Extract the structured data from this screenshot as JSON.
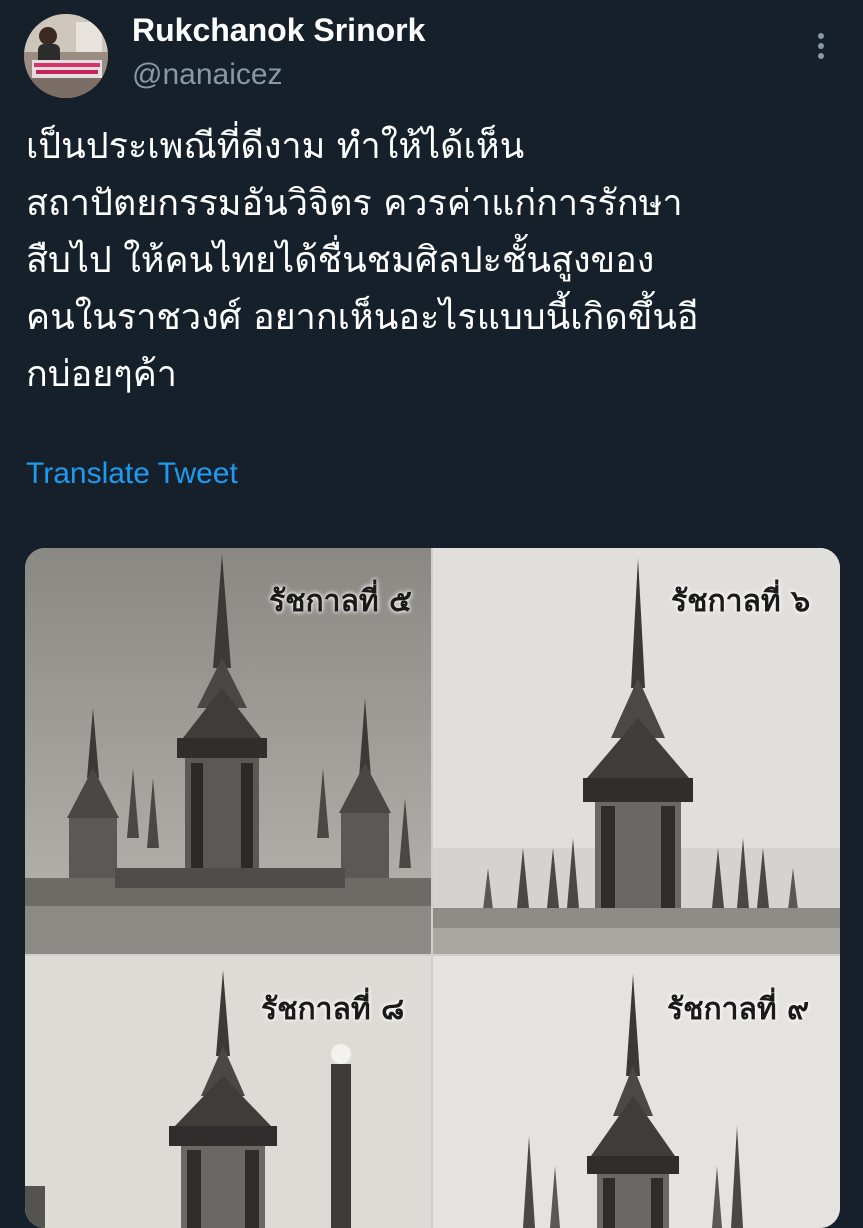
{
  "author": {
    "display_name": "Rukchanok Srinork",
    "handle": "@nanaicez"
  },
  "tweet": {
    "lines": [
      "เป็นประเพณีที่ดีงาม ทำให้ได้เห็น",
      "สถาปัตยกรรมอันวิจิตร ควรค่าแก่การรักษา",
      "สืบไป ให้คนไทยได้ชื่นชมศิลปะชั้นสูงของ",
      "คนในราชวงศ์ อยากเห็นอะไรแบบนี้เกิดขึ้นอี",
      "กบ่อยๆค้า"
    ],
    "translate_label": "Translate Tweet"
  },
  "media": {
    "panels": [
      {
        "label": "รัชกาลที่ ๕"
      },
      {
        "label": "รัชกาลที่ ๖"
      },
      {
        "label": "รัชกาลที่ ๘"
      },
      {
        "label": "รัชกาลที่ ๙"
      }
    ]
  },
  "icons": {
    "more": "more-vertical-icon"
  },
  "colors": {
    "background": "#15202b",
    "text": "#ffffff",
    "secondary_text": "#8899a6",
    "link": "#1d9bf0"
  }
}
